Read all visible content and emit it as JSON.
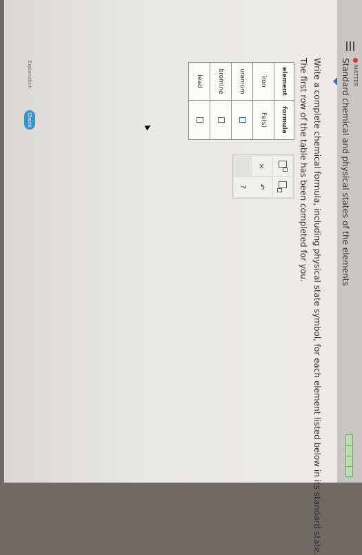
{
  "topic": "MATTER",
  "title": "Standard chemical and physical states of the elements",
  "instructions": "Write a complete chemical formula, including physical state symbol, for each element listed below in its standard state.",
  "note": "The first row of the table has been completed for you.",
  "table": {
    "headers": [
      "element",
      "formula"
    ],
    "rows": [
      {
        "element": "iron",
        "formula": "Fe(s)"
      },
      {
        "element": "uranium",
        "formula": ""
      },
      {
        "element": "bromine",
        "formula": ""
      },
      {
        "element": "lead",
        "formula": ""
      }
    ]
  },
  "palette": {
    "clear": "×",
    "undo": "↶",
    "help": "?"
  },
  "buttons": {
    "explanation": "Explanation",
    "check": "Check"
  },
  "colors": {
    "accent": "#3d92c6",
    "topic_dot": "#c33c3c",
    "progress": "#6aa85a"
  }
}
